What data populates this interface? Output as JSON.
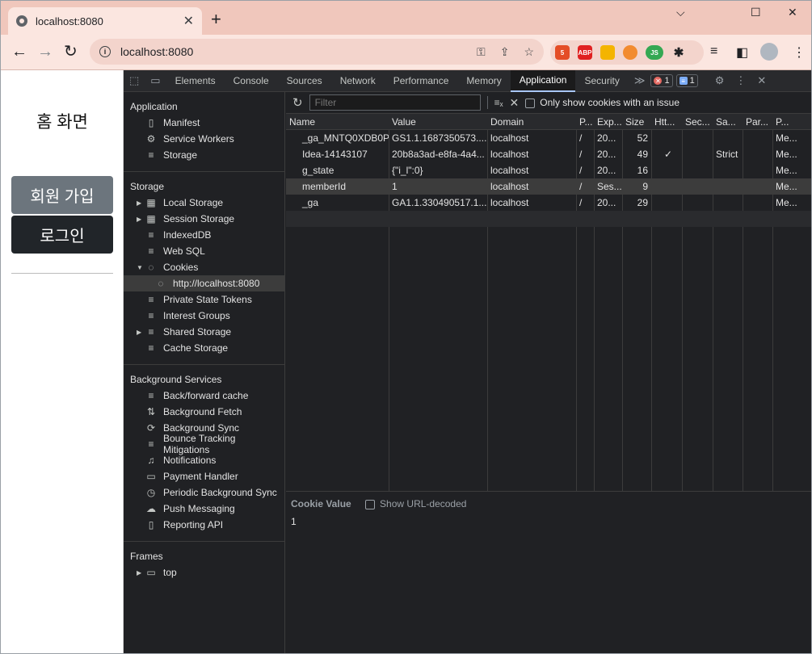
{
  "browser": {
    "tab_title": "localhost:8080",
    "url": "localhost:8080",
    "new_tab_glyph": "+",
    "close_tab_glyph": "✕",
    "window": {
      "minimize": "⌵",
      "maximize": "☐",
      "close": "✕"
    }
  },
  "page": {
    "title": "홈 화면",
    "signup_label": "회원 가입",
    "login_label": "로그인"
  },
  "devtools": {
    "tabs": [
      "Elements",
      "Console",
      "Sources",
      "Network",
      "Performance",
      "Memory",
      "Application",
      "Security"
    ],
    "active_tab": "Application",
    "more_glyph": "≫",
    "errors_count": "1",
    "messages_count": "1",
    "sidebar": {
      "application_title": "Application",
      "application_items": [
        "Manifest",
        "Service Workers",
        "Storage"
      ],
      "storage_title": "Storage",
      "storage_items": [
        "Local Storage",
        "Session Storage",
        "IndexedDB",
        "Web SQL",
        "Cookies"
      ],
      "cookie_origin": "http://localhost:8080",
      "storage_items_2": [
        "Private State Tokens",
        "Interest Groups",
        "Shared Storage",
        "Cache Storage"
      ],
      "background_title": "Background Services",
      "background_items": [
        "Back/forward cache",
        "Background Fetch",
        "Background Sync",
        "Bounce Tracking Mitigations",
        "Notifications",
        "Payment Handler",
        "Periodic Background Sync",
        "Push Messaging",
        "Reporting API"
      ],
      "frames_title": "Frames",
      "frames_items": [
        "top"
      ]
    },
    "cookies": {
      "filter_placeholder": "Filter",
      "only_issue_label": "Only show cookies with an issue",
      "columns": [
        "Name",
        "Value",
        "Domain",
        "P...",
        "Exp...",
        "Size",
        "Htt...",
        "Sec...",
        "Sa...",
        "Par...",
        "P..."
      ],
      "rows": [
        [
          "_ga_MNTQ0XDB0P",
          "GS1.1.1687350573....",
          "localhost",
          "/",
          "20...",
          "52",
          "",
          "",
          "",
          "",
          "Me..."
        ],
        [
          "Idea-14143107",
          "20b8a3ad-e8fa-4a4...",
          "localhost",
          "/",
          "20...",
          "49",
          "✓",
          "",
          "Strict",
          "",
          "Me..."
        ],
        [
          "g_state",
          "{\"i_l\":0}",
          "localhost",
          "/",
          "20...",
          "16",
          "",
          "",
          "",
          "",
          "Me..."
        ],
        [
          "memberId",
          "1",
          "localhost",
          "/",
          "Ses...",
          "9",
          "",
          "",
          "",
          "",
          "Me..."
        ],
        [
          "_ga",
          "GA1.1.330490517.1...",
          "localhost",
          "/",
          "20...",
          "29",
          "",
          "",
          "",
          "",
          "Me..."
        ]
      ],
      "selected_row": 3,
      "cookie_value_label": "Cookie Value",
      "show_url_decoded_label": "Show URL-decoded",
      "cookie_value": "1"
    }
  }
}
